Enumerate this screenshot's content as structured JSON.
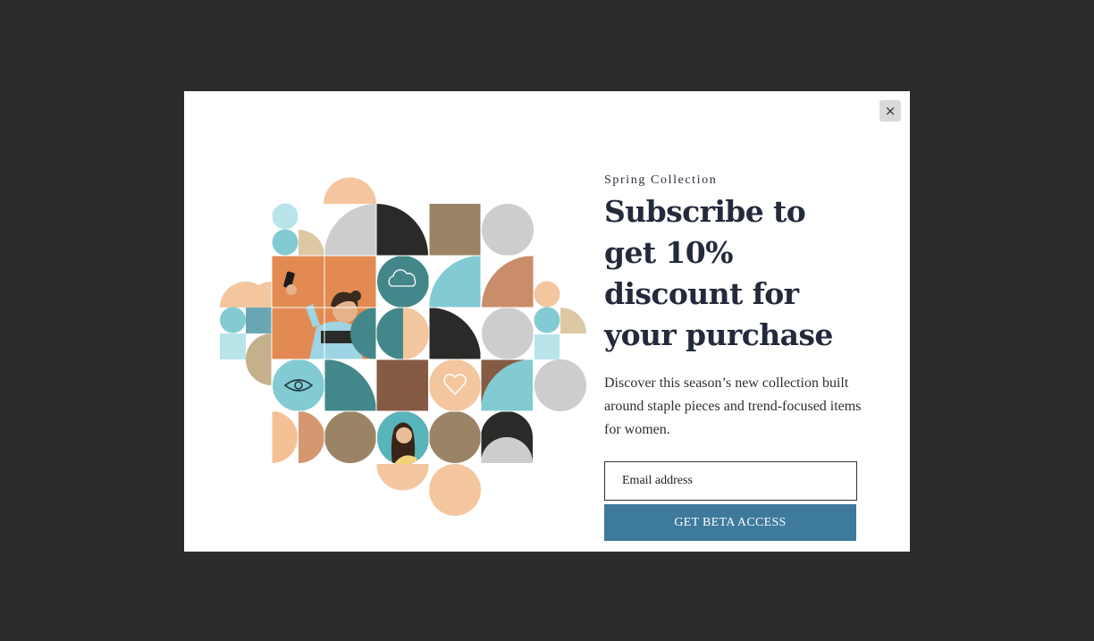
{
  "popup": {
    "close_label": "×",
    "eyebrow": "Spring Collection",
    "title": "Subscribe to get 10% discount for your purchase",
    "description": "Discover this season’s new collection built around staple pieces and trend-focused items for women.",
    "email_placeholder": "Email address",
    "cta_label": "GET BETA ACCESS"
  },
  "colors": {
    "overlay": "#2b2c2c",
    "cta": "#3e7a9b",
    "title": "#232a3b",
    "peach": "#f3c69f",
    "sky": "#82cbd3",
    "teal": "#44878a",
    "charcoal": "#2a2b28",
    "khaki": "#9b8466",
    "terracotta": "#c98d69",
    "brown": "#865b44",
    "grey": "#cdcdcd",
    "orange": "#e38a52"
  }
}
